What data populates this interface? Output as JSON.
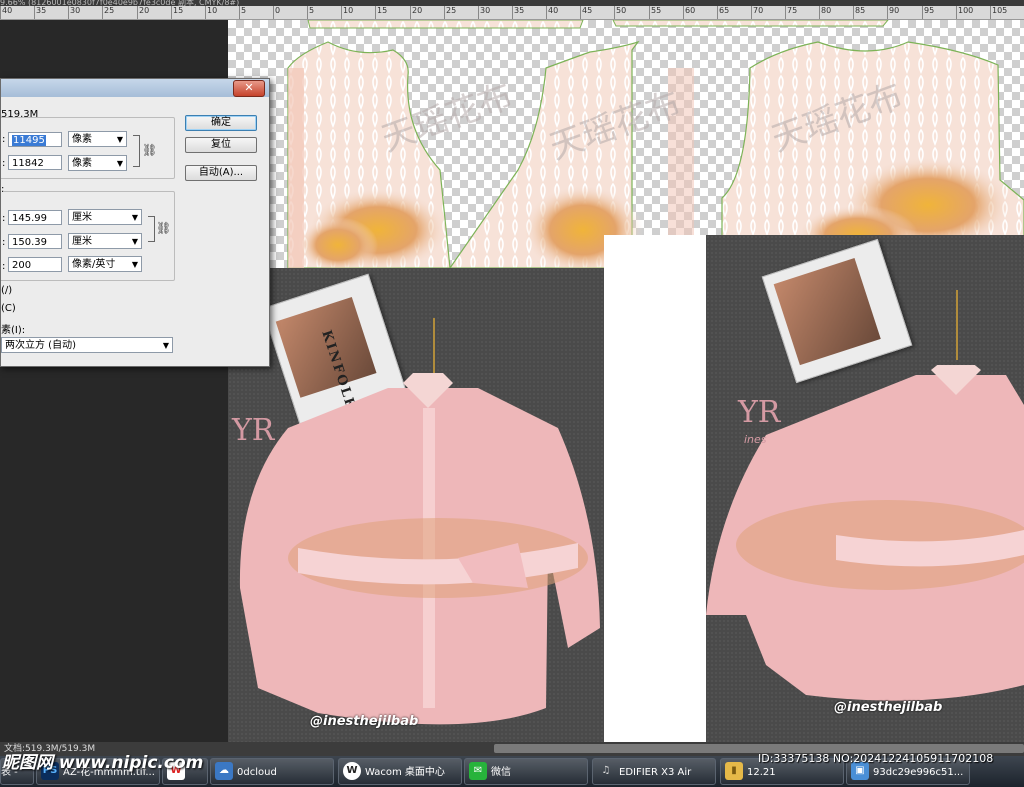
{
  "window": {
    "title_fragment": "9.66% (8126001e0830f7f0e40e9b7fe3c0de 副本, CMYK/8#)"
  },
  "ruler": {
    "ticks": [
      "40",
      "35",
      "30",
      "25",
      "20",
      "15",
      "10",
      "5",
      "0",
      "5",
      "10",
      "15",
      "20",
      "25",
      "30",
      "35",
      "40",
      "45",
      "50",
      "55",
      "60",
      "65",
      "70",
      "75",
      "80",
      "85",
      "90",
      "95",
      "100",
      "105"
    ]
  },
  "dialog": {
    "size_label": "519.3M",
    "width_px_label": ":",
    "width_px_value": "11495",
    "height_px_label": ":",
    "height_px_value": "11842",
    "px_unit": "像素",
    "doc_group_label": ":",
    "doc_width_value": "145.99",
    "doc_height_value": "150.39",
    "cm_unit": "厘米",
    "resolution_value": "200",
    "resolution_unit": "像素/英寸",
    "opt1": "(/)",
    "opt2": "(C)",
    "resample_label": "素(I):",
    "resample_value": "两次立方 (自动)",
    "ok_label": "确定",
    "reset_label": "复位",
    "auto_label": "自动(A)...",
    "close_label": "✕"
  },
  "canvas": {
    "watermark_text": "天瑶花布",
    "magazine_title": "KINFOLK",
    "logo_text": "YR",
    "logo_sub": "ines",
    "handle": "@inesthejilbab"
  },
  "status": {
    "text": "文档:519.3M/519.3M"
  },
  "taskbar": {
    "items": [
      {
        "label": "表 -",
        "icon": "app-icon"
      },
      {
        "label": "AZ-花-mmmm.tif...",
        "icon": "PS"
      },
      {
        "label": "",
        "icon": "W"
      },
      {
        "label": "0dcloud",
        "icon": "cloud"
      },
      {
        "label": "Wacom 桌面中心",
        "icon": "W"
      },
      {
        "label": "微信",
        "icon": "chat"
      },
      {
        "label": "EDIFIER X3 Air",
        "icon": "headphone"
      },
      {
        "label": "12.21",
        "icon": "folder"
      },
      {
        "label": "93dc29e996c51...",
        "icon": "image"
      }
    ]
  },
  "watermarks": {
    "nipic": "昵图网 www.nipic.com",
    "id": "ID:33375138 NO:20241224105911702108"
  },
  "colors": {
    "accent": "#3c7fb1",
    "pattern_pink": "#f6ddd2",
    "shirt_pink": "#eeb7b9"
  }
}
